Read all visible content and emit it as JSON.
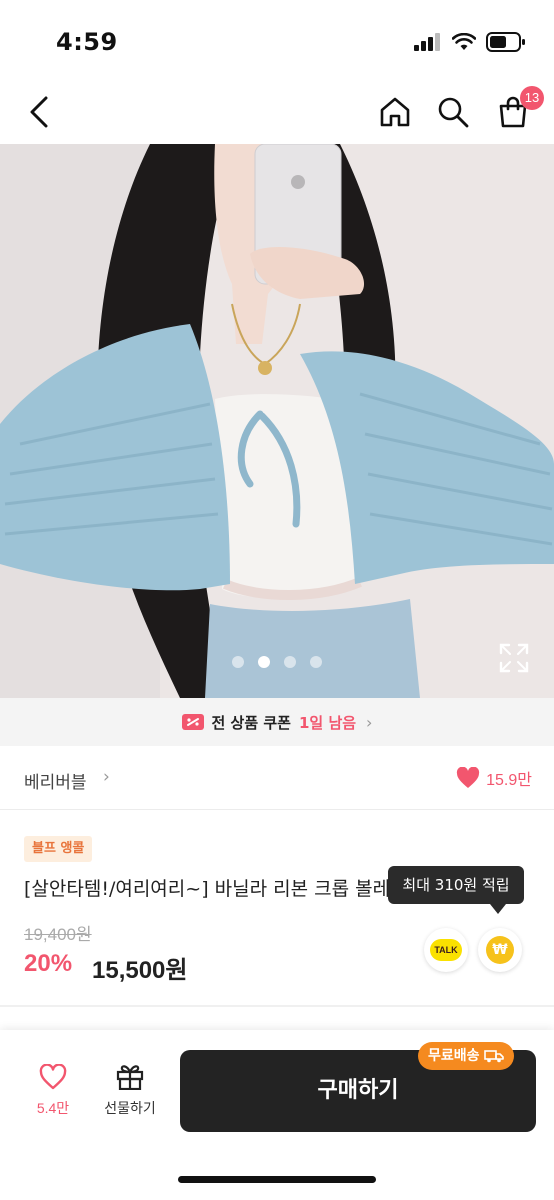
{
  "status_bar": {
    "time": "4:59"
  },
  "nav": {
    "cart_count": "13"
  },
  "hero": {
    "slide_count": 4,
    "active_slide": 2
  },
  "coupon": {
    "text": "전 상품 쿠폰",
    "accent": "1일 남음",
    "chevron": "›"
  },
  "brand": {
    "name": "베리버블",
    "chevron": "›",
    "like_count": "15.9만"
  },
  "product": {
    "badge": "블프 앵콜",
    "title": "[살안타템!/여리여리~] 바닐라 리본 크롭 볼레로 (1color)",
    "original_price": "19,400원",
    "discount": "20%",
    "sale_price": "15,500원",
    "reward_tooltip": "최대 310원 적립",
    "talk_label": "TALK",
    "point_symbol": "₩"
  },
  "bottom_bar": {
    "wish_count": "5.4만",
    "gift_label": "선물하기",
    "buy_label": "구매하기",
    "free_shipping_label": "무료배송"
  },
  "colors": {
    "accent": "#f2566e",
    "buy_button": "#232323",
    "free_shipping": "#f58a1f",
    "badge_bg": "#fdeede",
    "badge_text": "#e8743b"
  }
}
